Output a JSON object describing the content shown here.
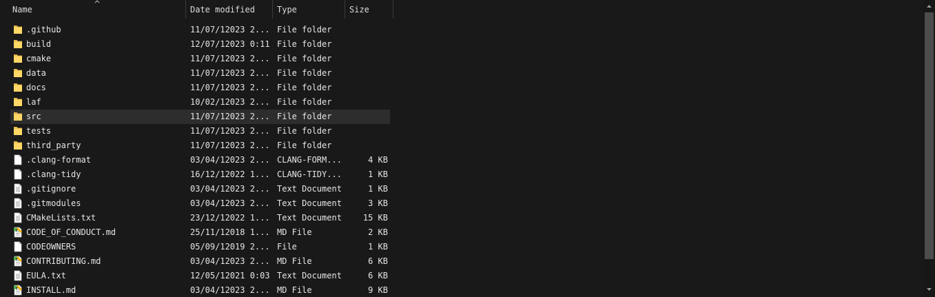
{
  "columns": {
    "name": "Name",
    "date_modified": "Date modified",
    "type": "Type",
    "size": "Size"
  },
  "files": [
    {
      "name": ".github",
      "date": "11/07/12023 2...",
      "type": "File folder",
      "size": "",
      "icon": "folder-icon"
    },
    {
      "name": "build",
      "date": "12/07/12023 0:11",
      "type": "File folder",
      "size": "",
      "icon": "folder-icon"
    },
    {
      "name": "cmake",
      "date": "11/07/12023 2...",
      "type": "File folder",
      "size": "",
      "icon": "folder-icon"
    },
    {
      "name": "data",
      "date": "11/07/12023 2...",
      "type": "File folder",
      "size": "",
      "icon": "folder-icon"
    },
    {
      "name": "docs",
      "date": "11/07/12023 2...",
      "type": "File folder",
      "size": "",
      "icon": "folder-icon"
    },
    {
      "name": "laf",
      "date": "10/02/12023 2...",
      "type": "File folder",
      "size": "",
      "icon": "folder-icon"
    },
    {
      "name": "src",
      "date": "11/07/12023 2...",
      "type": "File folder",
      "size": "",
      "icon": "folder-icon",
      "selected": true
    },
    {
      "name": "tests",
      "date": "11/07/12023 2...",
      "type": "File folder",
      "size": "",
      "icon": "folder-icon"
    },
    {
      "name": "third_party",
      "date": "11/07/12023 2...",
      "type": "File folder",
      "size": "",
      "icon": "folder-icon"
    },
    {
      "name": ".clang-format",
      "date": "03/04/12023 2...",
      "type": "CLANG-FORM...",
      "size": "4 KB",
      "icon": "blank-file-icon"
    },
    {
      "name": ".clang-tidy",
      "date": "16/12/12022 1...",
      "type": "CLANG-TIDY...",
      "size": "1 KB",
      "icon": "blank-file-icon"
    },
    {
      "name": ".gitignore",
      "date": "03/04/12023 2...",
      "type": "Text Document",
      "size": "1 KB",
      "icon": "text-file-icon"
    },
    {
      "name": ".gitmodules",
      "date": "03/04/12023 2...",
      "type": "Text Document",
      "size": "3 KB",
      "icon": "text-file-icon"
    },
    {
      "name": "CMakeLists.txt",
      "date": "23/12/12022 1...",
      "type": "Text Document",
      "size": "15 KB",
      "icon": "text-file-icon"
    },
    {
      "name": "CODE_OF_CONDUCT.md",
      "date": "25/11/12018 1...",
      "type": "MD File",
      "size": "2 KB",
      "icon": "markdown-file-icon"
    },
    {
      "name": "CODEOWNERS",
      "date": "05/09/12019 2...",
      "type": "File",
      "size": "1 KB",
      "icon": "blank-file-icon"
    },
    {
      "name": "CONTRIBUTING.md",
      "date": "03/04/12023 2...",
      "type": "MD File",
      "size": "6 KB",
      "icon": "markdown-file-icon"
    },
    {
      "name": "EULA.txt",
      "date": "12/05/12021 0:03",
      "type": "Text Document",
      "size": "6 KB",
      "icon": "text-file-icon"
    },
    {
      "name": "INSTALL.md",
      "date": "03/04/12023 2...",
      "type": "MD File",
      "size": "9 KB",
      "icon": "markdown-file-icon"
    }
  ],
  "colors": {
    "background": "#191919",
    "selected_row": "#2d2d2d",
    "folder": "#ffd766",
    "text": "#e6e6e6"
  }
}
